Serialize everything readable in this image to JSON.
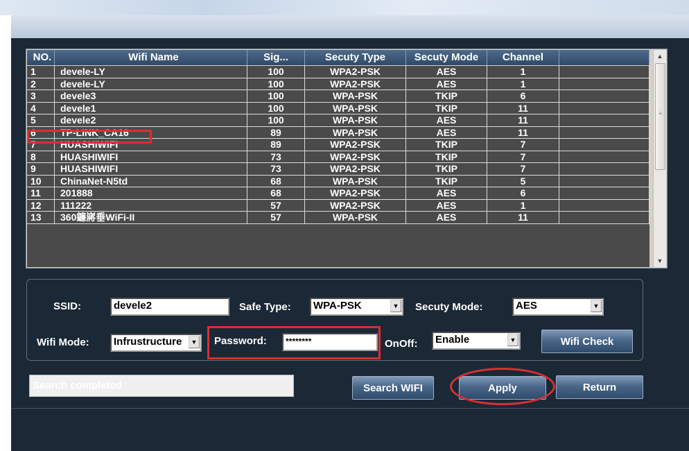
{
  "table": {
    "columns": [
      "NO.",
      "Wifi Name",
      "Sig...",
      "Secuty Type",
      "Secuty Mode",
      "Channel",
      ""
    ],
    "rows": [
      [
        "1",
        "devele-LY",
        "100",
        "WPA2-PSK",
        "AES",
        "1"
      ],
      [
        "2",
        "devele-LY",
        "100",
        "WPA2-PSK",
        "AES",
        "1"
      ],
      [
        "3",
        "devele3",
        "100",
        "WPA-PSK",
        "TKIP",
        "6"
      ],
      [
        "4",
        "devele1",
        "100",
        "WPA-PSK",
        "TKIP",
        "11"
      ],
      [
        "5",
        "devele2",
        "100",
        "WPA-PSK",
        "AES",
        "11"
      ],
      [
        "6",
        "TP-LINK_CA16",
        "89",
        "WPA-PSK",
        "AES",
        "11"
      ],
      [
        "7",
        "HUASHIWIFI",
        "89",
        "WPA2-PSK",
        "TKIP",
        "7"
      ],
      [
        "8",
        "HUASHIWIFI",
        "73",
        "WPA2-PSK",
        "TKIP",
        "7"
      ],
      [
        "9",
        "HUASHIWIFI",
        "73",
        "WPA2-PSK",
        "TKIP",
        "7"
      ],
      [
        "10",
        "ChinaNet-N5td",
        "68",
        "WPA-PSK",
        "TKIP",
        "5"
      ],
      [
        "11",
        "201888",
        "68",
        "WPA2-PSK",
        "AES",
        "6"
      ],
      [
        "12",
        "111222",
        "57",
        "WPA2-PSK",
        "AES",
        "1"
      ],
      [
        "13",
        "360鐮嶈垂WiFi-II",
        "57",
        "WPA-PSK",
        "AES",
        "11"
      ]
    ]
  },
  "settings": {
    "ssid_label": "SSID:",
    "ssid_value": "devele2",
    "safe_type_label": "Safe Type:",
    "safe_type_value": "WPA-PSK",
    "secuty_mode_label": "Secuty Mode:",
    "secuty_mode_value": "AES",
    "wifi_mode_label": "Wifi Mode:",
    "wifi_mode_value": "Infrustructure",
    "password_label": "Password:",
    "password_value": "********",
    "onoff_label": "OnOff:",
    "onoff_value": "Enable",
    "wifi_check_label": "Wifi Check"
  },
  "status_text": "Search completed",
  "buttons": {
    "search": "Search WIFI",
    "apply": "Apply",
    "return": "Return"
  },
  "icons": {
    "scroll_up": "▲",
    "scroll_down": "▼",
    "dropdown": "▼",
    "grip": "≡"
  },
  "colors": {
    "window_bg": "#1b2836",
    "table_rows_bg": "#4a4a4a",
    "highlight": "#d93030"
  }
}
